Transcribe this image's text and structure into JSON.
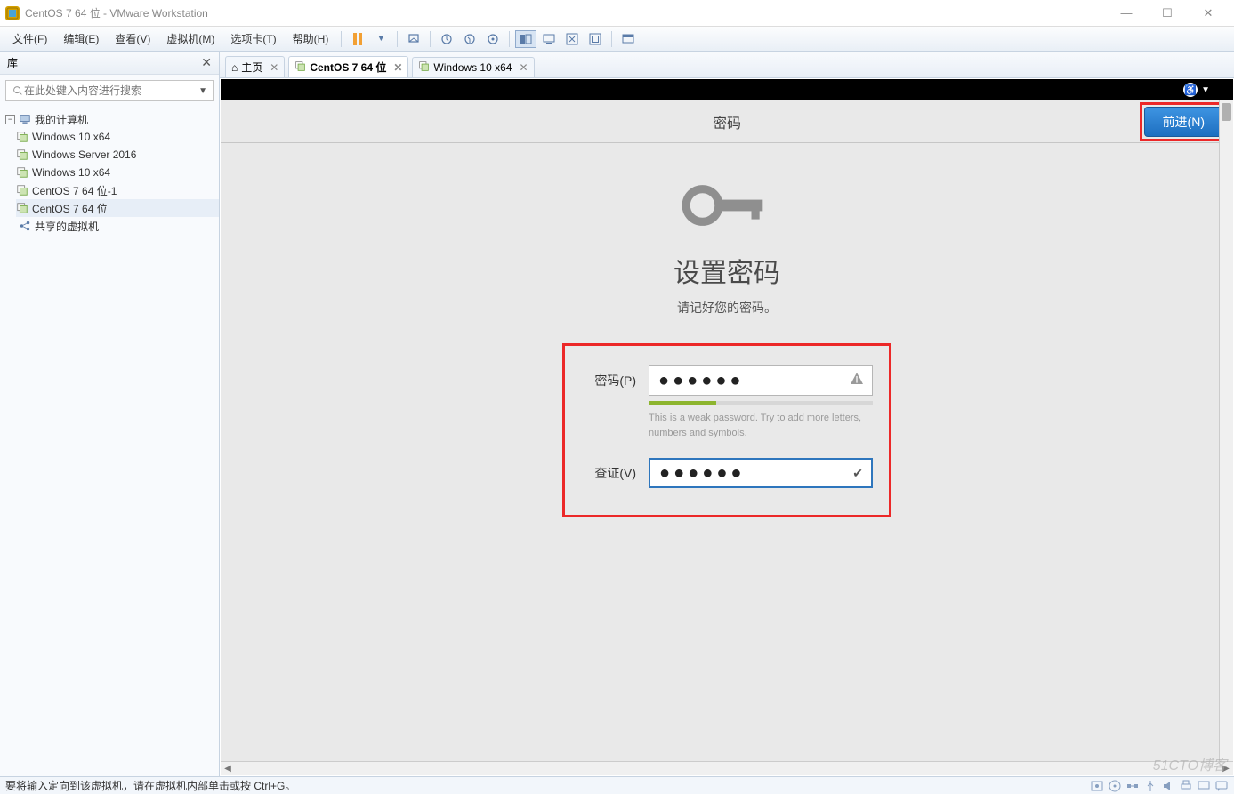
{
  "window": {
    "title": "CentOS 7 64 位 - VMware Workstation"
  },
  "menu": {
    "file": "文件(F)",
    "edit": "编辑(E)",
    "view": "查看(V)",
    "vm": "虚拟机(M)",
    "tabs": "选项卡(T)",
    "help": "帮助(H)"
  },
  "sidebar": {
    "header": "库",
    "search_placeholder": "在此处键入内容进行搜索",
    "root": "我的计算机",
    "items": [
      "Windows 10 x64",
      "Windows Server 2016",
      "Windows 10 x64",
      "CentOS 7 64 位-1",
      "CentOS 7 64 位"
    ],
    "shared": "共享的虚拟机"
  },
  "tabs": {
    "home": "主页",
    "tab1": "CentOS 7 64 位",
    "tab2": "Windows 10 x64"
  },
  "vm": {
    "header_title": "密码",
    "next_button": "前进(N)",
    "h1": "设置密码",
    "subtitle": "请记好您的密码。",
    "password_label": "密码(P)",
    "verify_label": "查证(V)",
    "password_dots": "●●●●●●",
    "verify_dots": "●●●●●●",
    "hint": "This is a weak password. Try to add more letters, numbers and symbols."
  },
  "status": {
    "text": "要将输入定向到该虚拟机，请在虚拟机内部单击或按 Ctrl+G。"
  },
  "watermark": "51CTO博客"
}
